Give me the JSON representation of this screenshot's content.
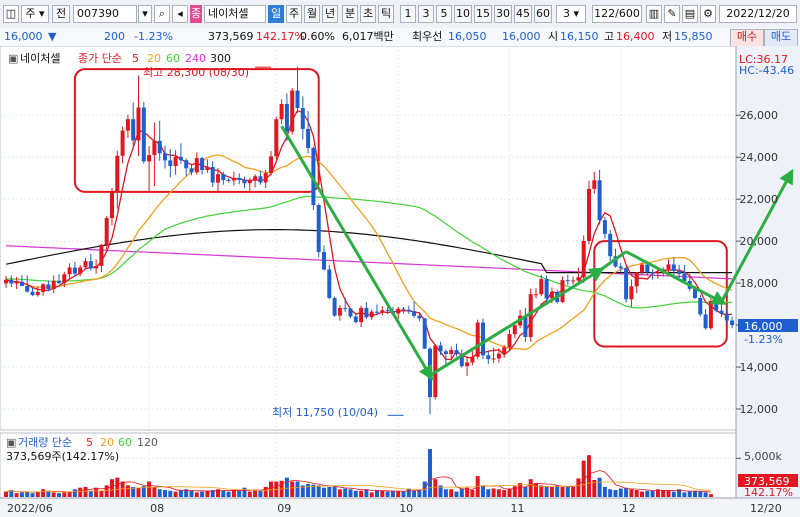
{
  "toolbar": {
    "market": "주",
    "prefix": "전",
    "code": "007390",
    "stock_name": "네이처셀",
    "tabs": [
      "일",
      "주",
      "월",
      "년",
      "분",
      "초",
      "틱"
    ],
    "intervals": [
      "1",
      "3",
      "5",
      "10",
      "15",
      "30",
      "45",
      "60"
    ],
    "interval_value": "3",
    "count": "122/600",
    "date": "2022/12/20"
  },
  "quote": {
    "price": "16,000",
    "change": "200",
    "change_pct": "-1.23%",
    "volume": "373,569",
    "volume_ratio": "142.17%",
    "turnover": "0.60%",
    "amount": "6,017백만",
    "preferred_label": "최우선",
    "ask": "16,050",
    "bid": "16,000",
    "open_label": "시",
    "open": "16,150",
    "high_label": "고",
    "high": "16,400",
    "low_label": "저",
    "low": "15,850",
    "buy_label": "매수",
    "sell_label": "매도"
  },
  "legend": {
    "name": "네이처셀",
    "ma_label": "종가 단순",
    "periods": [
      "5",
      "20",
      "60",
      "240",
      "300"
    ]
  },
  "vol_legend": {
    "label": "거래량 단순",
    "periods": [
      "5",
      "20",
      "60",
      "120"
    ],
    "value": "373,569주(142.17%)"
  },
  "axis_info": {
    "lc": "LC:36.17",
    "hc": "HC:-43.46",
    "price_tag": "16,000",
    "pct_tag": "-1.23%",
    "vol_unit": "5,000k",
    "vol_tag": "373,569",
    "vol_pct_tag": "142.17%"
  },
  "annotations": {
    "high": "최고 28,300 (08/30)",
    "low": "최저 11,750 (10/04)"
  },
  "colors": {
    "up": "#e3151f",
    "down": "#1e5ed0",
    "ma5": "#e3151f",
    "ma20": "#f2a01e",
    "ma60": "#43d139",
    "ma240": "#d832d3",
    "ma300": "#111111",
    "arrow": "#2cad44",
    "box": "#e3151f"
  },
  "chart_data": {
    "type": "candlestick",
    "title": "네이처셀 (007390) 일봉",
    "x_labels": [
      "2022/06",
      "08",
      "09",
      "10",
      "11",
      "12",
      "12/20"
    ],
    "y_ticks": [
      12000,
      14000,
      16000,
      18000,
      20000,
      22000,
      24000,
      26000
    ],
    "ylim": [
      11000,
      29300
    ],
    "volume_ticks_k": [
      5000
    ],
    "grid": true,
    "series": [
      {
        "name": "MA5",
        "period": 5
      },
      {
        "name": "MA20",
        "period": 20
      },
      {
        "name": "MA60",
        "period": 60
      },
      {
        "name": "MA240",
        "period": 240
      },
      {
        "name": "MA300",
        "period": 300
      }
    ],
    "candles": [
      [
        17990,
        18340,
        17760,
        18160
      ],
      [
        18160,
        18360,
        17810,
        17980
      ],
      [
        17980,
        18290,
        17720,
        18070
      ],
      [
        18070,
        18380,
        17860,
        17860
      ],
      [
        17860,
        18370,
        17550,
        17590
      ],
      [
        17590,
        17780,
        17380,
        17430
      ],
      [
        17430,
        17830,
        17360,
        17580
      ],
      [
        17580,
        18000,
        17400,
        17940
      ],
      [
        17940,
        18130,
        17610,
        17720
      ],
      [
        17720,
        18360,
        17520,
        18110
      ],
      [
        18110,
        18420,
        17950,
        18000
      ],
      [
        18000,
        18540,
        17810,
        18420
      ],
      [
        18420,
        18940,
        18160,
        18740
      ],
      [
        18740,
        19010,
        18310,
        18450
      ],
      [
        18450,
        18860,
        18320,
        18750
      ],
      [
        18750,
        19190,
        18690,
        19050
      ],
      [
        19050,
        19400,
        18600,
        18700
      ],
      [
        18700,
        19130,
        18450,
        18820
      ],
      [
        18820,
        19870,
        18530,
        19830
      ],
      [
        19830,
        21200,
        19590,
        21100
      ],
      [
        21100,
        22530,
        20760,
        22350
      ],
      [
        22350,
        24310,
        21550,
        24070
      ],
      [
        24070,
        25460,
        23700,
        25270
      ],
      [
        25270,
        26030,
        24920,
        25810
      ],
      [
        25810,
        26610,
        24520,
        24800
      ],
      [
        24800,
        27890,
        24060,
        26370
      ],
      [
        26370,
        26640,
        23690,
        23800
      ],
      [
        23800,
        24530,
        22380,
        24100
      ],
      [
        24100,
        25650,
        22620,
        24780
      ],
      [
        24780,
        25740,
        23830,
        24190
      ],
      [
        24190,
        24550,
        23460,
        23850
      ],
      [
        23850,
        24390,
        23040,
        23580
      ],
      [
        23580,
        24350,
        23160,
        24020
      ],
      [
        24020,
        24660,
        23690,
        23860
      ],
      [
        23860,
        23940,
        23100,
        23470
      ],
      [
        23470,
        23680,
        23140,
        23280
      ],
      [
        23280,
        24230,
        23170,
        23960
      ],
      [
        23960,
        24020,
        23180,
        23390
      ],
      [
        23390,
        23900,
        23260,
        23540
      ],
      [
        23540,
        23810,
        22580,
        22790
      ],
      [
        22790,
        23480,
        22390,
        23190
      ],
      [
        23190,
        23310,
        22690,
        22910
      ],
      [
        22910,
        23000,
        22800,
        22890
      ],
      [
        22890,
        23310,
        22650,
        23010
      ],
      [
        23010,
        23230,
        22710,
        22920
      ],
      [
        22920,
        23070,
        22510,
        22760
      ],
      [
        22760,
        23000,
        22370,
        22880
      ],
      [
        22880,
        23190,
        22560,
        23090
      ],
      [
        23090,
        23370,
        22690,
        22800
      ],
      [
        22800,
        23390,
        22530,
        23240
      ],
      [
        23240,
        24290,
        23120,
        24040
      ],
      [
        24040,
        25930,
        23910,
        25810
      ],
      [
        25810,
        26760,
        25570,
        26540
      ],
      [
        26540,
        27040,
        24770,
        25220
      ],
      [
        25220,
        27300,
        25080,
        27180
      ],
      [
        27180,
        28300,
        26110,
        26340
      ],
      [
        26340,
        26900,
        24840,
        25350
      ],
      [
        25350,
        26200,
        24180,
        24440
      ],
      [
        24440,
        24510,
        21480,
        21720
      ],
      [
        21720,
        21790,
        19240,
        19480
      ],
      [
        19480,
        19800,
        18600,
        18650
      ],
      [
        18650,
        18870,
        17230,
        17290
      ],
      [
        17290,
        17350,
        16390,
        16450
      ],
      [
        16450,
        16950,
        16210,
        16820
      ],
      [
        16820,
        17290,
        16630,
        16790
      ],
      [
        16790,
        16820,
        16330,
        16410
      ],
      [
        16410,
        16550,
        16080,
        16140
      ],
      [
        16140,
        16920,
        15910,
        16820
      ],
      [
        16820,
        17100,
        16280,
        16370
      ],
      [
        16370,
        16750,
        16250,
        16640
      ],
      [
        16640,
        16980,
        16460,
        16590
      ],
      [
        16590,
        16900,
        16460,
        16710
      ],
      [
        16710,
        16860,
        16520,
        16670
      ],
      [
        16670,
        16860,
        16450,
        16550
      ],
      [
        16550,
        16860,
        16280,
        16780
      ],
      [
        16780,
        16860,
        16560,
        16730
      ],
      [
        16730,
        16920,
        16530,
        16660
      ],
      [
        16660,
        17130,
        16350,
        16440
      ],
      [
        16440,
        16570,
        16190,
        16320
      ],
      [
        16320,
        16340,
        14860,
        14880
      ],
      [
        14880,
        14950,
        11750,
        12570
      ],
      [
        12570,
        15100,
        12450,
        15030
      ],
      [
        15030,
        15210,
        14570,
        14750
      ],
      [
        14750,
        14840,
        14120,
        14620
      ],
      [
        14620,
        14970,
        14360,
        14810
      ],
      [
        14810,
        15110,
        14500,
        14610
      ],
      [
        14610,
        14840,
        13970,
        14040
      ],
      [
        14040,
        14510,
        13570,
        14220
      ],
      [
        14220,
        14760,
        14080,
        14490
      ],
      [
        14490,
        16260,
        14370,
        16120
      ],
      [
        16120,
        16310,
        14390,
        14560
      ],
      [
        14560,
        14770,
        14150,
        14380
      ],
      [
        14380,
        14930,
        14190,
        14410
      ],
      [
        14410,
        14890,
        14210,
        14640
      ],
      [
        14640,
        15050,
        14440,
        14940
      ],
      [
        14940,
        15790,
        14810,
        15570
      ],
      [
        15570,
        16030,
        15380,
        15980
      ],
      [
        15980,
        16720,
        15860,
        16450
      ],
      [
        16450,
        16820,
        15200,
        15430
      ],
      [
        15430,
        17740,
        15220,
        17470
      ],
      [
        17470,
        17760,
        17290,
        17470
      ],
      [
        17470,
        18390,
        17380,
        18190
      ],
      [
        18190,
        18360,
        17100,
        17270
      ],
      [
        17270,
        17790,
        17040,
        17580
      ],
      [
        17580,
        17690,
        17020,
        17100
      ],
      [
        17100,
        18320,
        17060,
        18140
      ],
      [
        18140,
        18400,
        17910,
        18130
      ],
      [
        18130,
        18310,
        17940,
        18130
      ],
      [
        18130,
        18750,
        17960,
        18280
      ],
      [
        18280,
        20280,
        18010,
        20010
      ],
      [
        20010,
        22880,
        19840,
        22490
      ],
      [
        22490,
        23310,
        22270,
        22900
      ],
      [
        22900,
        23400,
        20800,
        21000
      ],
      [
        21000,
        21150,
        20130,
        20350
      ],
      [
        20350,
        20540,
        19050,
        19280
      ],
      [
        19280,
        19640,
        18740,
        18790
      ],
      [
        18790,
        18960,
        18530,
        18710
      ],
      [
        18710,
        18800,
        17060,
        17230
      ],
      [
        17230,
        18170,
        16860,
        17850
      ],
      [
        17850,
        18530,
        17530,
        18510
      ],
      [
        18510,
        18980,
        18390,
        18880
      ],
      [
        18880,
        18970,
        18360,
        18520
      ],
      [
        18520,
        18670,
        18170,
        18500
      ],
      [
        18500,
        18720,
        18200,
        18510
      ],
      [
        18510,
        18750,
        18320,
        18660
      ],
      [
        18660,
        19130,
        18320,
        18890
      ],
      [
        18890,
        19250,
        18330,
        18580
      ],
      [
        18580,
        18870,
        18110,
        18440
      ],
      [
        18440,
        18870,
        18040,
        18100
      ],
      [
        18100,
        18430,
        17640,
        17730
      ],
      [
        17730,
        17860,
        17250,
        17290
      ],
      [
        17290,
        17430,
        16400,
        16510
      ],
      [
        16510,
        16770,
        15780,
        15850
      ],
      [
        15850,
        17270,
        15780,
        17150
      ],
      [
        17150,
        17430,
        16610,
        16690
      ],
      [
        16690,
        17090,
        16390,
        16540
      ],
      [
        16540,
        16760,
        16020,
        16220
      ],
      [
        16220,
        16400,
        15850,
        16000
      ]
    ],
    "volume_k": [
      700,
      900,
      500,
      600,
      650,
      500,
      700,
      1000,
      800,
      600,
      500,
      600,
      700,
      1000,
      1200,
      1300,
      800,
      1200,
      800,
      1500,
      2300,
      2500,
      2000,
      1500,
      1300,
      1200,
      1400,
      2000,
      1300,
      1000,
      900,
      800,
      700,
      900,
      1000,
      800,
      600,
      700,
      800,
      900,
      1000,
      800,
      700,
      900,
      800,
      1200,
      700,
      900,
      800,
      1300,
      2000,
      2000,
      2100,
      2500,
      2000,
      2000,
      1500,
      1700,
      1600,
      1500,
      1200,
      1300,
      1300,
      1000,
      1100,
      1000,
      800,
      800,
      1000,
      600,
      900,
      800,
      700,
      800,
      700,
      700,
      1100,
      800,
      900,
      2000,
      6200,
      2300,
      1500,
      1000,
      1000,
      700,
      1100,
      1200,
      900,
      2700,
      1400,
      1000,
      1100,
      1000,
      900,
      1100,
      1400,
      1800,
      1300,
      2300,
      1800,
      1500,
      1400,
      1300,
      1500,
      1300,
      1300,
      1300,
      2400,
      4700,
      5400,
      2200,
      2500,
      1300,
      1000,
      900,
      1100,
      1200,
      1000,
      900,
      700,
      800,
      800,
      1000,
      900,
      800,
      700,
      1000,
      600,
      700,
      800,
      700,
      600,
      374
    ]
  }
}
